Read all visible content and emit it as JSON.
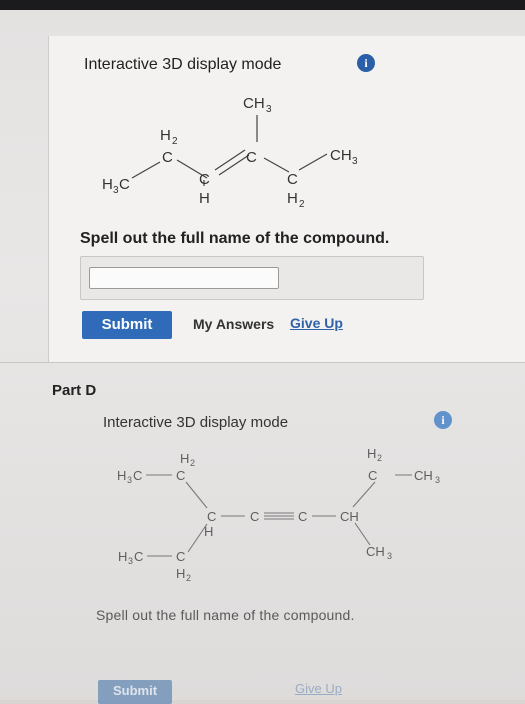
{
  "part_c": {
    "title": "Interactive 3D display mode",
    "info_symbol": "i",
    "molecule_labels": {
      "top_ch3": "CH",
      "top_ch3_sub": "3",
      "h2_top": "H",
      "h2_top_sub": "2",
      "c_left": "C",
      "c_mid": "C",
      "ch3_right": "CH",
      "ch3_right_sub": "3",
      "h3c_left": "H",
      "h3c_left_sub": "3",
      "h3c_left_c": "C",
      "c_low1": "C",
      "h_low1": "H",
      "c_low2": "C",
      "h2_low": "H",
      "h2_low_sub": "2"
    },
    "prompt": "Spell out the full name of the compound.",
    "answer_value": "",
    "submit_label": "Submit",
    "my_answers_label": "My Answers",
    "give_up_label": "Give Up"
  },
  "part_d": {
    "heading": "Part D",
    "title": "Interactive 3D display mode",
    "info_symbol": "i",
    "molecule_labels": {
      "h2_top_left": "H",
      "h2_top_left_sub": "2",
      "h3c_top": "H",
      "h3c_top_sub": "3",
      "h3c_top_c": "C",
      "c_top_left": "C",
      "h2_top_right": "H",
      "h2_top_right_sub": "2",
      "c_top_right": "C",
      "ch3_top_right": "CH",
      "ch3_top_right_sub": "3",
      "c_center": "C",
      "c_triple_1": "C",
      "c_triple_2": "C",
      "ch_right": "CH",
      "h_center": "H",
      "ch3_low_right": "CH",
      "ch3_low_right_sub": "3",
      "h3c_low": "H",
      "h3c_low_sub": "3",
      "h3c_low_c": "C",
      "c_low": "C",
      "h2_low": "H",
      "h2_low_sub": "2"
    },
    "prompt": "Spell out the full name of the compound.",
    "submit_label": "Submit",
    "give_up_label": "Give Up"
  }
}
